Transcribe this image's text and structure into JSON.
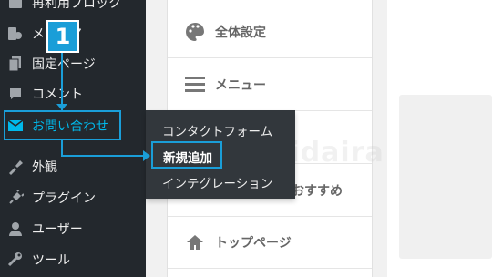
{
  "sidebar": {
    "items": [
      {
        "label": "再利用ブロック",
        "icon": "reusable-block-icon"
      },
      {
        "label": "メディア",
        "icon": "media-icon"
      },
      {
        "label": "固定ページ",
        "icon": "pages-icon"
      },
      {
        "label": "コメント",
        "icon": "comments-icon"
      },
      {
        "label": "お問い合わせ",
        "icon": "mail-icon"
      },
      {
        "label": "外観",
        "icon": "appearance-icon"
      },
      {
        "label": "プラグイン",
        "icon": "plugins-icon"
      },
      {
        "label": "ユーザー",
        "icon": "users-icon"
      },
      {
        "label": "ツール",
        "icon": "tools-icon"
      }
    ]
  },
  "flyout": {
    "items": [
      {
        "label": "コンタクトフォーム"
      },
      {
        "label": "新規追加"
      },
      {
        "label": "インテグレーション"
      }
    ]
  },
  "settings": {
    "items": [
      {
        "label": "全体設定",
        "icon": "palette-icon"
      },
      {
        "label": "メニュー",
        "icon": "menu-icon"
      },
      {
        "label": "おすすめ",
        "icon": "recommend-icon"
      },
      {
        "label": "トップページ",
        "icon": "home-icon"
      }
    ]
  },
  "annotation": {
    "step_number": "1",
    "accent_color": "#1a9ed8"
  },
  "watermark": "hidaira"
}
